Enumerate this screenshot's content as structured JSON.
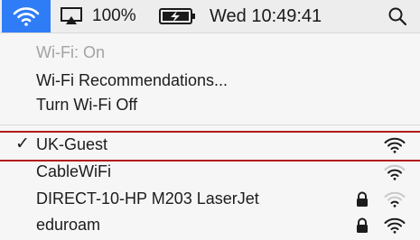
{
  "menubar": {
    "wifi_icon": "wifi-icon",
    "airplay_icon": "airplay-icon",
    "battery_percent": "100%",
    "battery_icon": "battery-charging-icon",
    "clock": "Wed 10:49:41",
    "search_icon": "spotlight-search-icon",
    "accent_color": "#2f7df6"
  },
  "menu": {
    "status": "Wi-Fi: On",
    "recommendations": "Wi-Fi Recommendations...",
    "toggle": "Turn Wi-Fi Off",
    "networks": [
      {
        "name": "UK-Guest",
        "connected": true,
        "check": "✓",
        "locked": false,
        "signal_bars": 3
      },
      {
        "name": "CableWiFi",
        "connected": false,
        "check": "",
        "locked": false,
        "signal_bars": 2
      },
      {
        "name": "DIRECT-10-HP M203 LaserJet",
        "connected": false,
        "check": "",
        "locked": true,
        "signal_bars": 1
      },
      {
        "name": "eduroam",
        "connected": false,
        "check": "",
        "locked": true,
        "signal_bars": 3
      }
    ]
  },
  "annotation_color": "#b21b1b"
}
